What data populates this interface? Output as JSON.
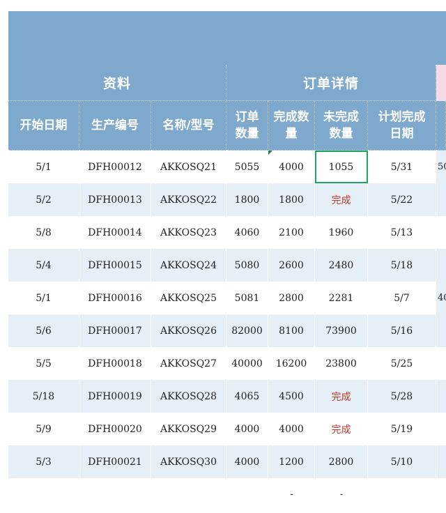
{
  "sheet": {
    "group_headers": [
      {
        "label": "资料"
      },
      {
        "label": "订单详情"
      }
    ],
    "column_headers": [
      {
        "line1": "开始日期",
        "line2": ""
      },
      {
        "line1": "生产编号",
        "line2": ""
      },
      {
        "line1": "名称/型号",
        "line2": ""
      },
      {
        "line1": "订单",
        "line2": "数量"
      },
      {
        "line1": "完成数",
        "line2": "量"
      },
      {
        "line1": "未完成",
        "line2": "数量"
      },
      {
        "line1": "计划完成",
        "line2": "日期"
      },
      {
        "line1": "",
        "line2": ""
      }
    ],
    "rows": [
      {
        "start": "5/1",
        "code": "DFH00012",
        "model": "AKKOSQ21",
        "qty": "5055",
        "done": "4000",
        "remain": "1055",
        "plan": "5/31",
        "extra": "50"
      },
      {
        "start": "5/2",
        "code": "DFH00013",
        "model": "AKKOSQ22",
        "qty": "1800",
        "done": "1800",
        "remain": "完成",
        "plan": "5/22",
        "extra": ""
      },
      {
        "start": "5/8",
        "code": "DFH00014",
        "model": "AKKOSQ23",
        "qty": "4060",
        "done": "2100",
        "remain": "1960",
        "plan": "5/13",
        "extra": ""
      },
      {
        "start": "5/4",
        "code": "DFH00015",
        "model": "AKKOSQ24",
        "qty": "5080",
        "done": "2600",
        "remain": "2480",
        "plan": "5/18",
        "extra": ""
      },
      {
        "start": "5/1",
        "code": "DFH00016",
        "model": "AKKOSQ25",
        "qty": "5081",
        "done": "2800",
        "remain": "2281",
        "plan": "5/7",
        "extra": "40"
      },
      {
        "start": "5/6",
        "code": "DFH00017",
        "model": "AKKOSQ26",
        "qty": "82000",
        "done": "8100",
        "remain": "73900",
        "plan": "5/16",
        "extra": ""
      },
      {
        "start": "5/5",
        "code": "DFH00018",
        "model": "AKKOSQ27",
        "qty": "40000",
        "done": "16200",
        "remain": "23800",
        "plan": "5/25",
        "extra": ""
      },
      {
        "start": "5/18",
        "code": "DFH00019",
        "model": "AKKOSQ28",
        "qty": "4065",
        "done": "4500",
        "remain": "完成",
        "plan": "5/28",
        "extra": ""
      },
      {
        "start": "5/9",
        "code": "DFH00020",
        "model": "AKKOSQ29",
        "qty": "4000",
        "done": "4000",
        "remain": "完成",
        "plan": "5/19",
        "extra": ""
      },
      {
        "start": "5/3",
        "code": "DFH00021",
        "model": "AKKOSQ30",
        "qty": "4000",
        "done": "1200",
        "remain": "2800",
        "plan": "5/10",
        "extra": ""
      }
    ],
    "trailing_row": {
      "done": "-",
      "remain": "-"
    },
    "colors": {
      "header_bg": "#7ea9cc",
      "stripe_bg": "#e6eef6",
      "done_text": "#c0392b",
      "selection": "#21a366",
      "pink_header": "#f7d9e8"
    },
    "selected_cell": {
      "row": 0,
      "column": "remain"
    }
  }
}
